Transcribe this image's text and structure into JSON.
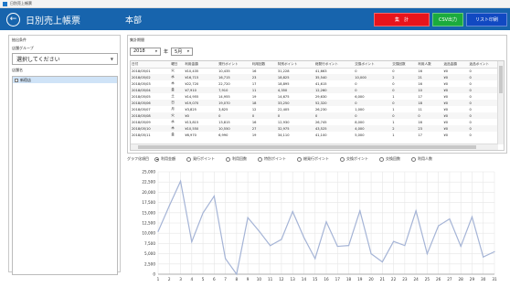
{
  "window": {
    "title": "日別売上帳票"
  },
  "header": {
    "title": "日別売上帳票",
    "store_name": "本部",
    "buttons": {
      "calculate": "集　計",
      "csv": "CSV出力",
      "print": "リスト印刷"
    }
  },
  "left": {
    "section_label": "抽出条件",
    "group_label": "店舗グループ",
    "group_selected": "選択してください",
    "store_label": "店舗名",
    "stores": [
      "新宿店"
    ]
  },
  "right": {
    "section_label": "集計期間",
    "year": "2018",
    "year_unit": "年",
    "month": "5月",
    "table": {
      "headers": [
        "日付",
        "曜日",
        "利用金額",
        "発行ポイント",
        "利用回数",
        "特別ポイント",
        "総発行ポイント",
        "交換ポイント",
        "交換回数",
        "利用人数",
        "返品金額",
        "返品ポイント"
      ],
      "rows": [
        [
          "2018/05/01",
          "火",
          "¥10,435",
          "10,435",
          "16",
          "31,228",
          "41,663",
          "0",
          "0",
          "16",
          "¥0",
          "0"
        ],
        [
          "2018/05/02",
          "水",
          "¥16,715",
          "16,715",
          "23",
          "18,825",
          "35,540",
          "10,000",
          "2",
          "21",
          "¥0",
          "0"
        ],
        [
          "2018/05/03",
          "木",
          "¥22,720",
          "22,720",
          "17",
          "18,895",
          "41,615",
          "0",
          "0",
          "16",
          "¥0",
          "0"
        ],
        [
          "2018/05/04",
          "金",
          "¥7,910",
          "7,910",
          "11",
          "4,350",
          "12,260",
          "0",
          "0",
          "10",
          "¥0",
          "0"
        ],
        [
          "2018/05/05",
          "土",
          "¥14,955",
          "14,955",
          "19",
          "14,675",
          "29,630",
          "6,000",
          "1",
          "17",
          "¥0",
          "0"
        ],
        [
          "2018/05/06",
          "日",
          "¥19,070",
          "19,070",
          "18",
          "33,250",
          "52,320",
          "0",
          "0",
          "18",
          "¥0",
          "0"
        ],
        [
          "2018/05/07",
          "月",
          "¥3,825",
          "3,825",
          "12",
          "22,405",
          "26,230",
          "1,000",
          "1",
          "11",
          "¥0",
          "0"
        ],
        [
          "2018/05/08",
          "火",
          "¥0",
          "0",
          "0",
          "0",
          "0",
          "0",
          "0",
          "0",
          "¥0",
          "0"
        ],
        [
          "2018/05/09",
          "水",
          "¥13,815",
          "13,815",
          "16",
          "12,930",
          "26,745",
          "8,000",
          "1",
          "16",
          "¥0",
          "0"
        ],
        [
          "2018/05/10",
          "木",
          "¥10,550",
          "10,550",
          "27",
          "32,975",
          "43,525",
          "4,000",
          "2",
          "23",
          "¥0",
          "0"
        ],
        [
          "2018/05/11",
          "金",
          "¥6,970",
          "6,990",
          "19",
          "34,110",
          "41,100",
          "5,000",
          "1",
          "17",
          "¥0",
          "0"
        ]
      ]
    }
  },
  "chart": {
    "item_label": "グラフ化項目",
    "options": [
      "利用金額",
      "発行ポイント",
      "利用回数",
      "特別ポイント",
      "総発行ポイント",
      "交換ポイント",
      "交換回数",
      "利用人数"
    ],
    "selected_index": 0
  },
  "chart_data": {
    "type": "line",
    "title": "",
    "xlabel": "",
    "ylabel": "",
    "x": [
      1,
      2,
      3,
      4,
      5,
      6,
      7,
      8,
      9,
      10,
      11,
      12,
      13,
      14,
      15,
      16,
      17,
      18,
      19,
      20,
      21,
      22,
      23,
      24,
      25,
      26,
      27,
      28,
      29,
      30,
      31
    ],
    "series": [
      {
        "values": [
          10435,
          16715,
          22720,
          7910,
          14955,
          19070,
          3825,
          0,
          13815,
          10550,
          6970,
          8500,
          15300,
          9000,
          3800,
          12800,
          6800,
          7000,
          15500,
          5000,
          3000,
          8000,
          7000,
          15500,
          5000,
          11800,
          13500,
          6800,
          14000,
          4200,
          5500
        ]
      }
    ],
    "ylim": [
      0,
      25000
    ],
    "yticks": [
      0,
      2500,
      5000,
      7500,
      10000,
      12500,
      15000,
      17500,
      20000,
      22500,
      25000
    ],
    "ytick_labels": [
      "0",
      "2,500",
      "5,000",
      "7,500",
      "10,000",
      "12,500",
      "15,000",
      "17,500",
      "20,000",
      "22,500",
      "25,000"
    ],
    "grid": true,
    "color": "#a5b4d6"
  }
}
